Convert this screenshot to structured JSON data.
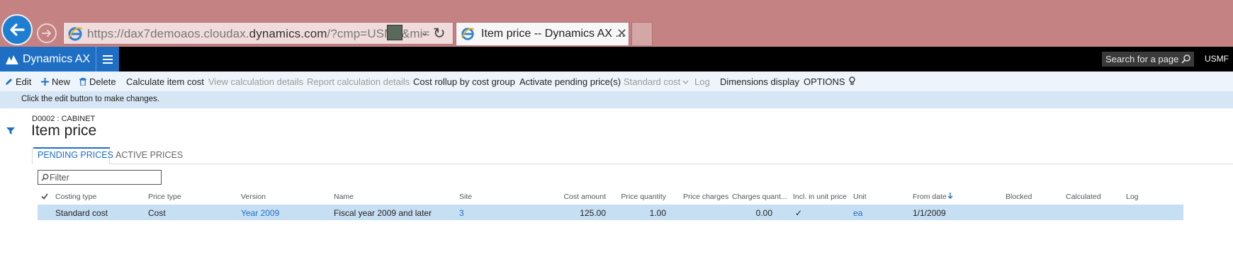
{
  "browser": {
    "address_prefix": "https://dax7demoaos.cloudax.",
    "address_domain": "dynamics.com",
    "address_suffix": "/?cmp=USMF&mi=",
    "tab_title": "Item price -- Dynamics AX ..."
  },
  "header": {
    "brand": "Dynamics AX",
    "search_placeholder": "Search for a page",
    "company": "USMF"
  },
  "actions": {
    "edit": "Edit",
    "new": "New",
    "delete": "Delete",
    "calculate_item_cost": "Calculate item cost",
    "view_calculation_details": "View calculation details",
    "report_calculation_details": "Report calculation details",
    "cost_rollup": "Cost rollup by cost group",
    "activate_pending": "Activate pending price(s)",
    "standard_cost": "Standard cost",
    "log": "Log",
    "dimensions_display": "Dimensions display",
    "options": "OPTIONS"
  },
  "message": "Click the edit button to make changes.",
  "page": {
    "caption": "D0002 : CABINET",
    "title": "Item price"
  },
  "tabs": {
    "pending": "PENDING PRICES",
    "active": "ACTIVE PRICES"
  },
  "filter": {
    "placeholder": "Filter"
  },
  "grid": {
    "columns": {
      "costing_type": "Costing type",
      "price_type": "Price type",
      "version": "Version",
      "name": "Name",
      "site": "Site",
      "cost_amount": "Cost amount",
      "price_quantity": "Price quantity",
      "price_charges": "Price charges",
      "charges_quantity": "Charges quant...",
      "incl_in_unit_price": "Incl. in unit price",
      "unit": "Unit",
      "from_date": "From date",
      "blocked": "Blocked",
      "calculated": "Calculated",
      "log": "Log"
    },
    "rows": [
      {
        "costing_type": "Standard cost",
        "price_type": "Cost",
        "version": "Year 2009",
        "name": "Fiscal year 2009 and later",
        "site": "3",
        "cost_amount": "125.00",
        "price_quantity": "1.00",
        "price_charges": "",
        "charges_quantity": "0.00",
        "incl_in_unit_price": "✓",
        "unit": "ea",
        "from_date": "1/1/2009",
        "blocked": "",
        "calculated": "",
        "log": ""
      }
    ]
  },
  "colors": {
    "brand_blue": "#1e6fc4",
    "chrome": "#c58282",
    "selected_row": "#c7dff3",
    "action_pane": "#eef4fb",
    "message_bar": "#d6e6f5"
  }
}
